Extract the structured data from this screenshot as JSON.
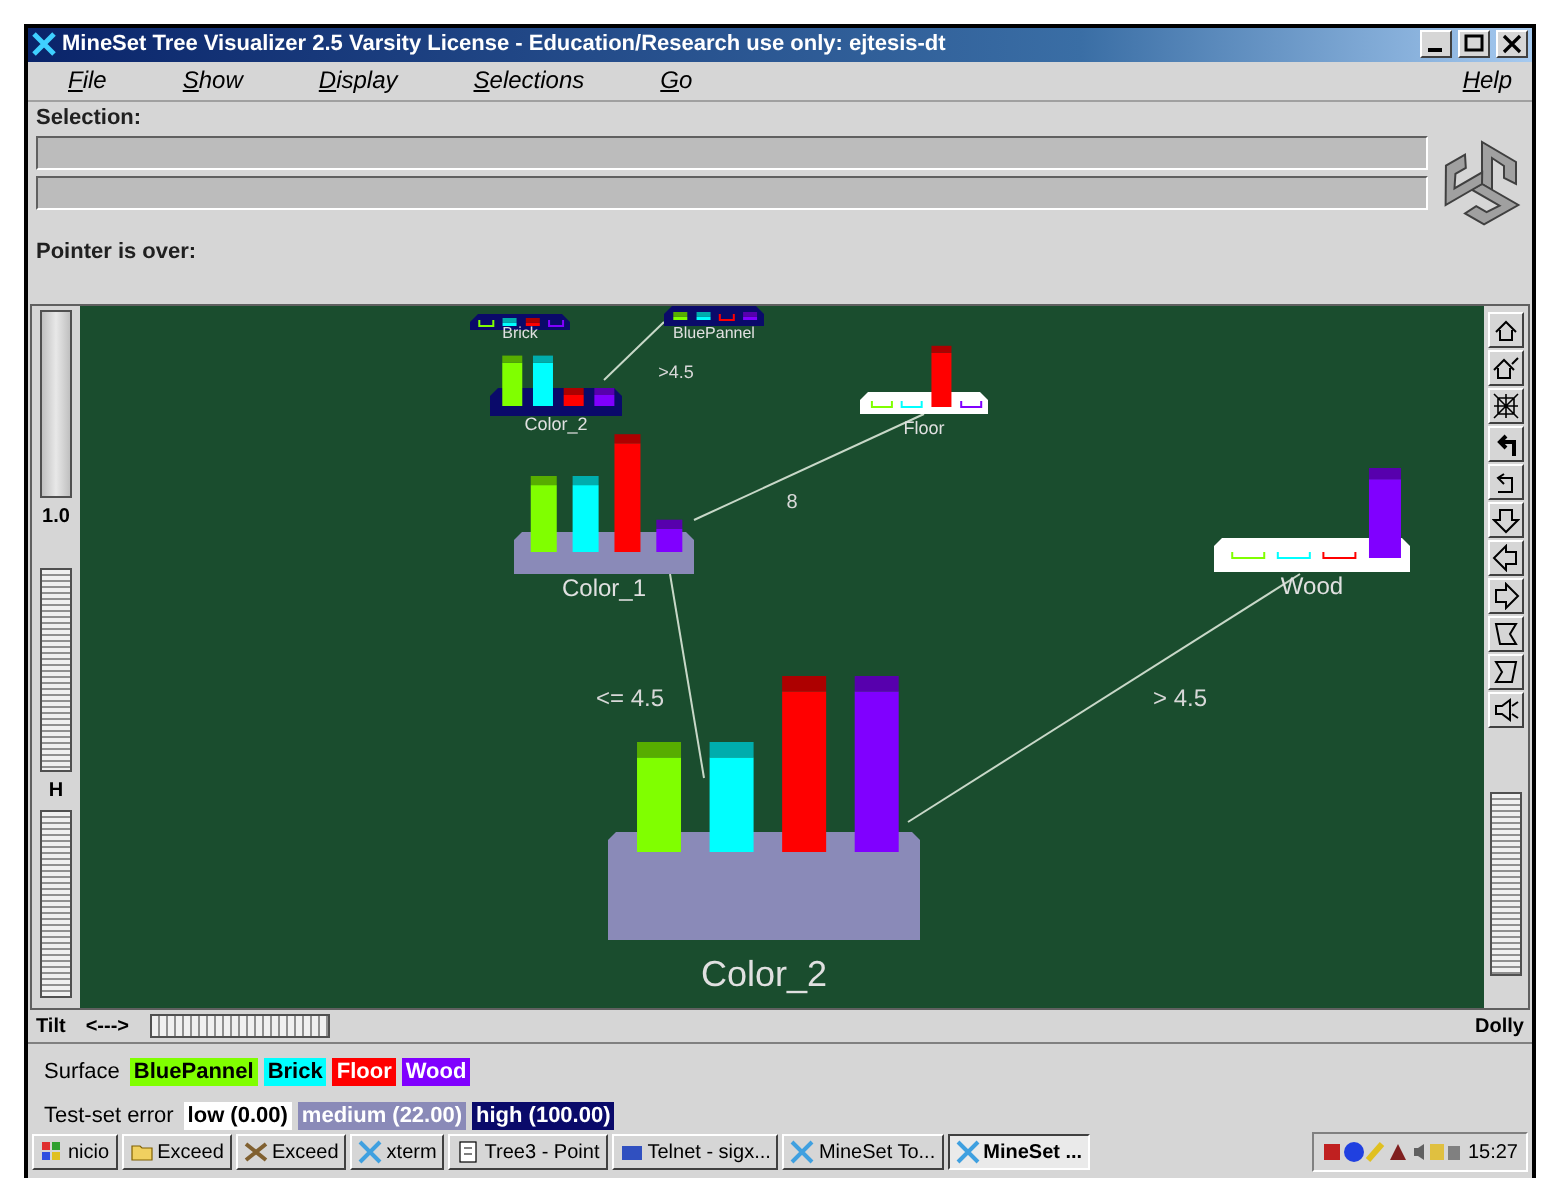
{
  "window": {
    "title": "MineSet Tree Visualizer 2.5  Varsity License - Education/Research use only: ejtesis-dt"
  },
  "menu": [
    {
      "label": "File"
    },
    {
      "label": "Show"
    },
    {
      "label": "Display"
    },
    {
      "label": "Selections"
    },
    {
      "label": "Go"
    }
  ],
  "help_menu": {
    "label": "Help"
  },
  "selection": {
    "label": "Selection:"
  },
  "pointer": {
    "label": "Pointer is over:"
  },
  "left_panel": {
    "scale_label": "1.0",
    "height_label": "H"
  },
  "tree": {
    "nodes": [
      {
        "label": "Color_2",
        "color": "#8a8ab8"
      },
      {
        "label": "Color_1",
        "color": "#8a8ab8"
      },
      {
        "label": "Floor",
        "color": "#ffffff"
      },
      {
        "label": "Wood",
        "color": "#ffffff"
      },
      {
        "label": "Color_2",
        "color": "#0a0a6a"
      },
      {
        "label": "Brick",
        "color": "#0a0a6a"
      },
      {
        "label": "BluePannel",
        "color": "#0a0a6a"
      }
    ],
    "edges": [
      {
        "label": "<= 4.5"
      },
      {
        "label": "> 4.5"
      },
      {
        "label": "8"
      },
      {
        "label": ">4.5"
      }
    ]
  },
  "bottom_bar": {
    "tilt": "Tilt",
    "arrows": "<--->",
    "dolly": "Dolly"
  },
  "surface_legend": {
    "label": "Surface",
    "items": [
      {
        "label": "BluePannel",
        "color": "#80ff00"
      },
      {
        "label": "Brick",
        "color": "#00ffff"
      },
      {
        "label": "Floor",
        "color": "#ff0000"
      },
      {
        "label": "Wood",
        "color": "#8000ff"
      }
    ]
  },
  "error_legend": {
    "label": "Test-set error",
    "items": [
      {
        "label": "low (0.00)",
        "color": "#ffffff"
      },
      {
        "label": "medium (22.00)",
        "color": "#8a8ab8"
      },
      {
        "label": "high (100.00)",
        "color": "#0a0a6a"
      }
    ]
  },
  "taskbar": {
    "start": "nicio",
    "items": [
      {
        "label": "Exceed",
        "selected": false
      },
      {
        "label": "Exceed",
        "selected": false
      },
      {
        "label": "xterm",
        "selected": false
      },
      {
        "label": "Tree3 - Point",
        "selected": false
      },
      {
        "label": "Telnet - sigx...",
        "selected": false
      },
      {
        "label": "MineSet To...",
        "selected": false
      },
      {
        "label": "MineSet ...",
        "selected": true
      }
    ],
    "clock": "15:27"
  }
}
